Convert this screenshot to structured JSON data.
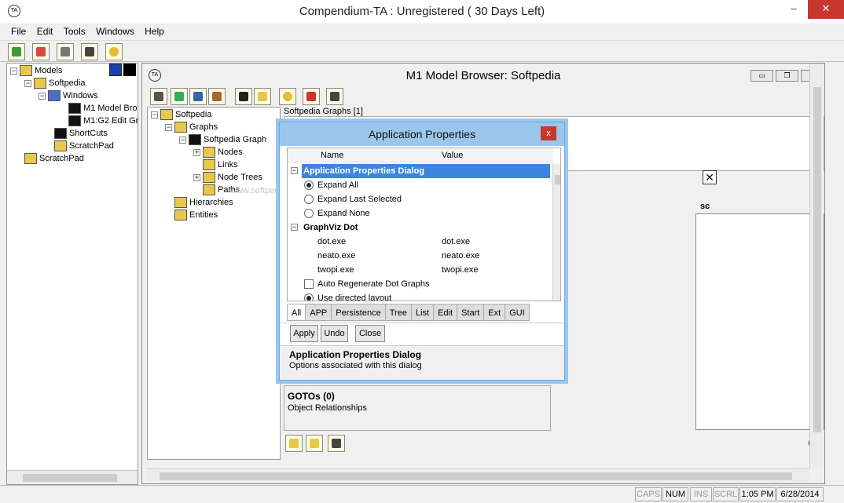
{
  "app": {
    "title": "Compendium-TA : Unregistered ( 30 Days Left)",
    "window_controls": [
      "–",
      "□",
      "✕"
    ]
  },
  "menu": [
    "File",
    "Edit",
    "Tools",
    "Windows",
    "Help"
  ],
  "left_tree": {
    "items": [
      {
        "label": "Models",
        "icon": "models-icon"
      },
      {
        "label": "Softpedia",
        "icon": "model-icon"
      },
      {
        "label": "Windows",
        "icon": "windows-icon"
      },
      {
        "label": "M1 Model Bro",
        "icon": "browser-window-icon"
      },
      {
        "label": "M1:G2 Edit Gr",
        "icon": "graph-window-icon"
      },
      {
        "label": "ShortCuts",
        "icon": "shortcuts-icon"
      },
      {
        "label": "ScratchPad",
        "icon": "scratchpad-icon"
      },
      {
        "label": "ScratchPad",
        "icon": "scratchpad-icon"
      }
    ]
  },
  "inner_window": {
    "title": "M1 Model Browser: Softpedia",
    "tree": [
      {
        "label": "Softpedia"
      },
      {
        "label": "Graphs"
      },
      {
        "label": "Softpedia Graph"
      },
      {
        "label": "Nodes"
      },
      {
        "label": "Links"
      },
      {
        "label": "Node Trees"
      },
      {
        "label": "Paths"
      },
      {
        "label": "Hierarchies"
      },
      {
        "label": "Entities"
      }
    ],
    "graphs_tab": "Softpedia Graphs [1]",
    "column_fragment": "sc",
    "gotos_title": "GOTOs (0)",
    "gotos_sub": "Object Relationships",
    "watermark": "www.softpedia.com"
  },
  "dialog": {
    "title": "Application Properties",
    "close": "x",
    "col_name": "Name",
    "col_value": "Value",
    "rows": {
      "section1": "Application Properties Dialog",
      "expand_all": "Expand All",
      "expand_last": "Expand Last Selected",
      "expand_none": "Expand None",
      "section2": "GraphViz Dot",
      "dot_name": "dot.exe",
      "dot_value": "dot.exe",
      "neato_name": "neato.exe",
      "neato_value": "neato.exe",
      "twopi_name": "twopi.exe",
      "twopi_value": "twopi.exe",
      "auto_regen": "Auto Regenerate Dot Graphs",
      "directed": "Use directed layout"
    },
    "tabs": [
      "All",
      "APP",
      "Persistence",
      "Tree",
      "List",
      "Edit",
      "Start",
      "Ext",
      "GUI"
    ],
    "buttons": {
      "apply": "Apply",
      "undo": "Undo",
      "close": "Close"
    },
    "desc_title": "Application Properties Dialog",
    "desc_text": "Options associated with this dialog"
  },
  "status": {
    "caps": "CAPS",
    "num": "NUM",
    "ins": "INS",
    "scrl": "SCRL",
    "time": "1:05 PM",
    "date": "6/28/2014"
  }
}
